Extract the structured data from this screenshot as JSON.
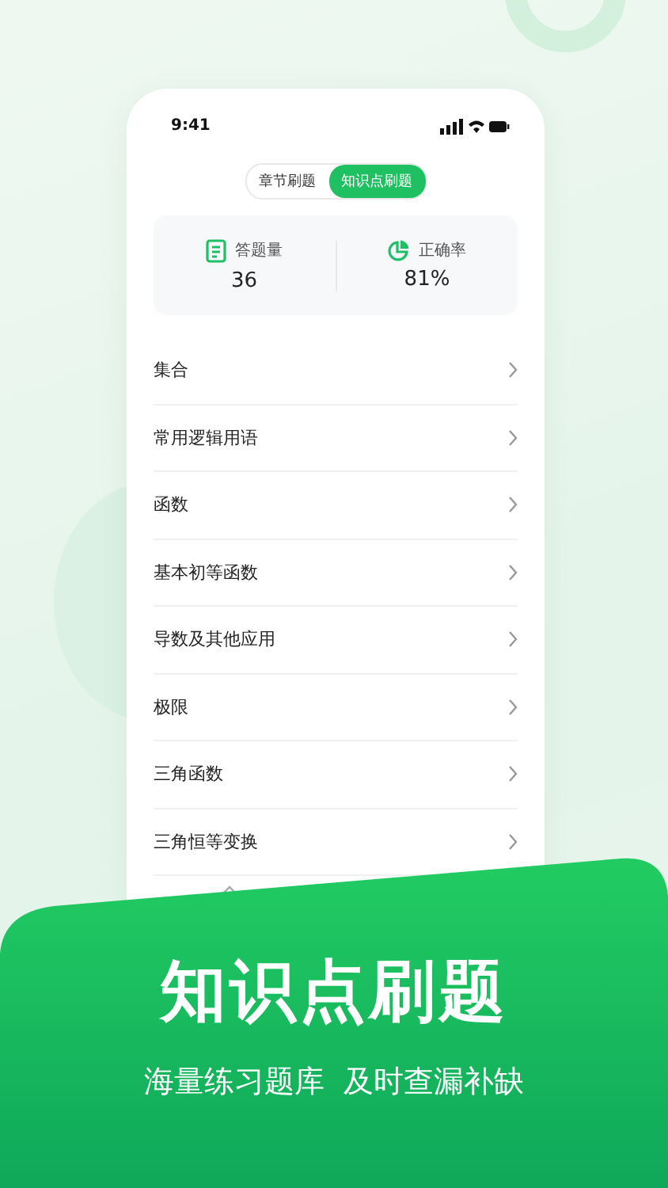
{
  "status_bar": {
    "time": "9:41"
  },
  "tabs": [
    {
      "label": "章节刷题",
      "selected": false
    },
    {
      "label": "知识点刷题",
      "selected": true
    }
  ],
  "stats": [
    {
      "kind": "document",
      "label": "答题量",
      "value": "36"
    },
    {
      "kind": "pie",
      "label": "正确率",
      "value": "81%"
    }
  ],
  "topics": [
    "集合",
    "常用逻辑用语",
    "函数",
    "基本初等函数",
    "导数及其他应用",
    "极限",
    "三角函数",
    "三角恒等变换"
  ],
  "banner": {
    "title": "知识点刷题",
    "subtitle": "海量练习题库  及时查漏补缺"
  }
}
